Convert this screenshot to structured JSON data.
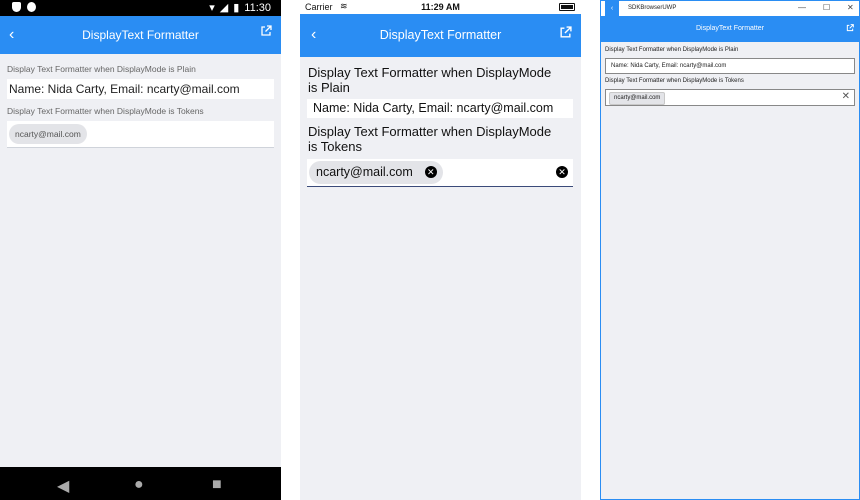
{
  "page_title": "DisplayText Formatter",
  "accent_color": "#2a8df3",
  "android": {
    "status_time": "11:30",
    "label_plain": "Display Text Formatter when DisplayMode is Plain",
    "plain_value": "Name: Nida Carty, Email: ncarty@mail.com",
    "label_tokens": "Display Text Formatter when DisplayMode is Tokens",
    "token": "ncarty@mail.com",
    "icons": [
      "shield-icon",
      "circle-icon",
      "wifi-icon",
      "signal-icon",
      "battery-icon",
      "back-icon",
      "external-link-icon",
      "nav-back-icon",
      "nav-home-icon",
      "nav-recents-icon"
    ]
  },
  "ios": {
    "carrier": "Carrier",
    "status_time": "11:29 AM",
    "label_plain": "Display Text Formatter when DisplayMode is Plain",
    "plain_value": "Name: Nida Carty, Email: ncarty@mail.com",
    "label_tokens": "Display Text Formatter when DisplayMode is Tokens",
    "token": "ncarty@mail.com",
    "icons": [
      "wifi-icon",
      "battery-icon",
      "back-icon",
      "external-link-icon",
      "token-remove-icon",
      "clear-icon"
    ]
  },
  "uwp": {
    "window_title": "SDKBrowserUWP",
    "controls": [
      "—",
      "☐",
      "✕"
    ],
    "label_plain": "Display Text Formatter when DisplayMode is Plain",
    "plain_value": "Name: Nida Carty, Email: ncarty@mail.com",
    "label_tokens": "Display Text Formatter when DisplayMode is Tokens",
    "token": "ncarty@mail.com",
    "clear": "✕",
    "icons": [
      "window-back-icon",
      "external-link-icon",
      "clear-icon"
    ]
  }
}
